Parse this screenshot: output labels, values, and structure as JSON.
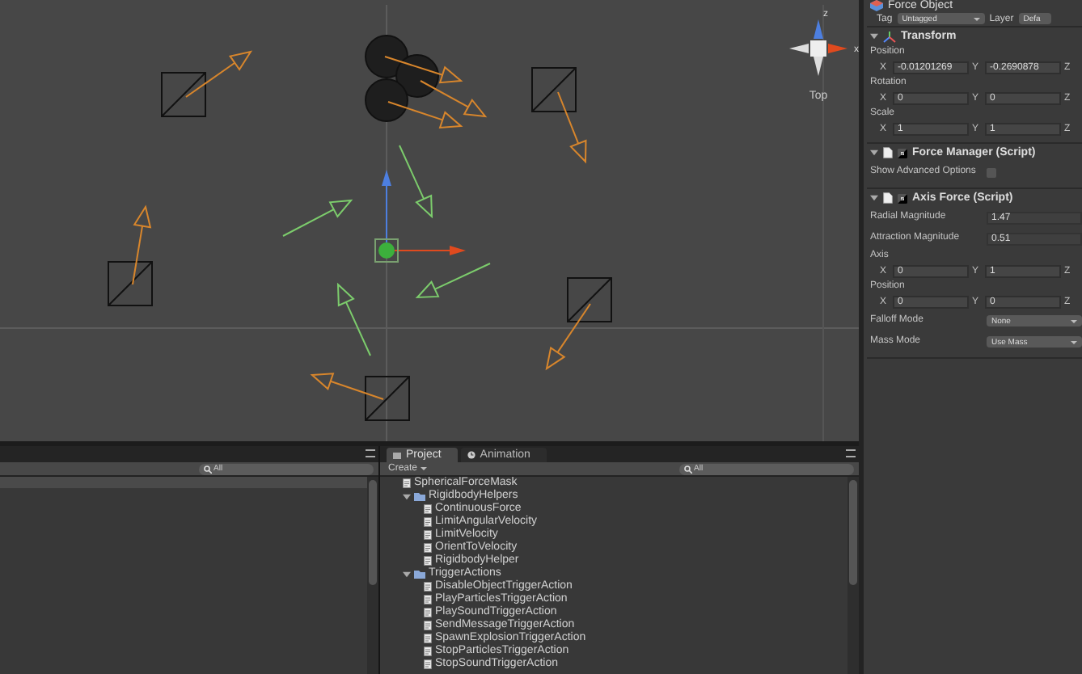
{
  "scene": {
    "gizmo": {
      "axis_labels": [
        "z",
        "x"
      ],
      "view": "Top"
    }
  },
  "inspector": {
    "object_name": "Force Object",
    "tag_label": "Tag",
    "tag": "Untagged",
    "layer_label": "Layer",
    "layer": "Defa",
    "components": [
      {
        "kind": "transform",
        "title": "Transform",
        "expanded": true,
        "properties": [
          {
            "kind": "vector",
            "label": "Position",
            "fields": [
              {
                "axis": "X",
                "value": "-0.01201269"
              },
              {
                "axis": "Y",
                "value": "-0.2690878"
              },
              {
                "axis": "Z"
              }
            ]
          },
          {
            "kind": "vector",
            "label": "Rotation",
            "fields": [
              {
                "axis": "X",
                "value": "0"
              },
              {
                "axis": "Y",
                "value": "0"
              },
              {
                "axis": "Z"
              }
            ]
          },
          {
            "kind": "vector",
            "label": "Scale",
            "fields": [
              {
                "axis": "X",
                "value": "1"
              },
              {
                "axis": "Y",
                "value": "1"
              },
              {
                "axis": "Z"
              }
            ]
          }
        ]
      },
      {
        "kind": "script",
        "title": "Force Manager (Script)",
        "expanded": true,
        "enabled": true,
        "properties": [
          {
            "kind": "toggle",
            "label": "Show Advanced Options",
            "checked": false
          }
        ]
      },
      {
        "kind": "script",
        "title": "Axis Force (Script)",
        "expanded": true,
        "enabled": true,
        "properties": [
          {
            "kind": "number",
            "label": "Radial Magnitude",
            "value": "1.47"
          },
          {
            "kind": "number",
            "label": "Attraction Magnitude",
            "value": "0.51"
          },
          {
            "kind": "vector",
            "label": "Axis",
            "fields": [
              {
                "axis": "X",
                "value": "0"
              },
              {
                "axis": "Y",
                "value": "1"
              },
              {
                "axis": "Z"
              }
            ]
          },
          {
            "kind": "vector",
            "label": "Position",
            "fields": [
              {
                "axis": "X",
                "value": "0"
              },
              {
                "axis": "Y",
                "value": "0"
              },
              {
                "axis": "Z"
              }
            ]
          },
          {
            "kind": "dropdown",
            "label": "Falloff Mode",
            "value": "None"
          },
          {
            "kind": "dropdown",
            "label": "Mass Mode",
            "value": "Use Mass"
          }
        ]
      }
    ]
  },
  "left_panel": {
    "search": {
      "placeholder": "All"
    }
  },
  "project_panel": {
    "tabs": [
      {
        "label": "Project",
        "selected": true
      },
      {
        "label": "Animation",
        "selected": false
      }
    ],
    "create_label": "Create",
    "search": {
      "placeholder": "All"
    },
    "tree": [
      {
        "kind": "script",
        "label": "SphericalForceMask"
      },
      {
        "kind": "folder",
        "label": "RigidbodyHelpers",
        "expanded": true,
        "children": [
          {
            "kind": "script",
            "label": "ContinuousForce"
          },
          {
            "kind": "script",
            "label": "LimitAngularVelocity"
          },
          {
            "kind": "script",
            "label": "LimitVelocity"
          },
          {
            "kind": "script",
            "label": "OrientToVelocity"
          },
          {
            "kind": "script",
            "label": "RigidbodyHelper"
          }
        ]
      },
      {
        "kind": "folder",
        "label": "TriggerActions",
        "expanded": true,
        "children": [
          {
            "kind": "script",
            "label": "DisableObjectTriggerAction"
          },
          {
            "kind": "script",
            "label": "PlayParticlesTriggerAction"
          },
          {
            "kind": "script",
            "label": "PlaySoundTriggerAction"
          },
          {
            "kind": "script",
            "label": "SendMessageTriggerAction"
          },
          {
            "kind": "script",
            "label": "SpawnExplosionTriggerAction"
          },
          {
            "kind": "script",
            "label": "StopParticlesTriggerAction"
          },
          {
            "kind": "script",
            "label": "StopSoundTriggerAction"
          }
        ]
      }
    ]
  }
}
